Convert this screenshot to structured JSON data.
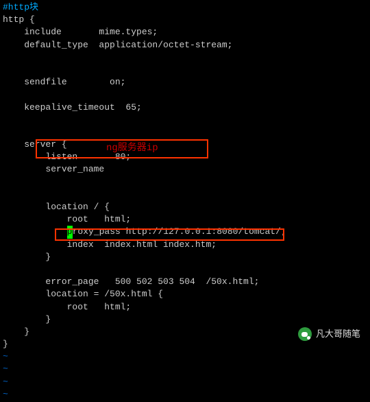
{
  "config": {
    "comment": "#http块",
    "httpOpen": "http {",
    "include": "    include       mime.types;",
    "defaultType": "    default_type  application/octet-stream;",
    "sendfile": "    sendfile        on;",
    "keepalive": "    keepalive_timeout  65;",
    "serverOpen": "    server {",
    "listen": "        listen       80;",
    "serverName": "        server_name",
    "locationOpen": "        location / {",
    "root": "            root   html;",
    "proxyPrefix": "            ",
    "proxyCursorChar": "p",
    "proxyPass": "roxy_pass http://127.0.0.1:8080/tomcat/;",
    "index": "            index  index.html index.htm;",
    "locationClose": "        }",
    "errorPage": "        error_page   500 502 503 504  /50x.html;",
    "location50xOpen": "        location = /50x.html {",
    "root50x": "            root   html;",
    "location50xClose": "        }",
    "serverClose": "    }",
    "httpClose": "}"
  },
  "highlights": {
    "annotation1": "ng服务器ip"
  },
  "tilde": "~",
  "watermark": {
    "text": "凡大哥随笔",
    "iconName": "wechat-icon"
  }
}
